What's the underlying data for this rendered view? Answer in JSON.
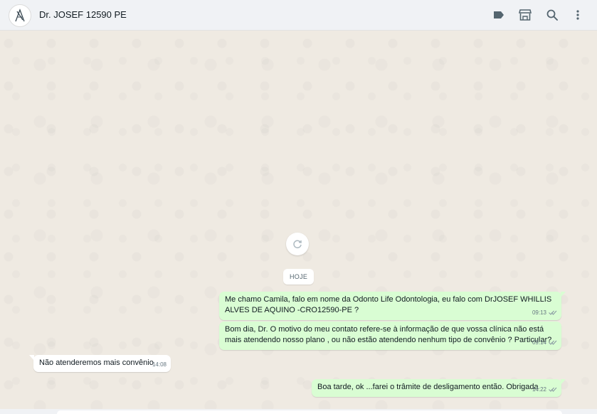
{
  "header": {
    "contact_name": "Dr. JOSEF 12590 PE",
    "icons": [
      "label-icon",
      "store-icon",
      "search-icon",
      "menu-icon"
    ]
  },
  "chat": {
    "day_label": "HOJE",
    "messages": [
      {
        "direction": "out",
        "text": "Me chamo Camila, falo em nome da Odonto Life Odontologia, eu falo com DrJOSEF WHILLIS ALVES DE AQUINO -CRO12590-PE ?",
        "time": "09:13",
        "status": "read"
      },
      {
        "direction": "out",
        "text": "Bom dia, Dr. O motivo do meu contato refere-se à informação de que vossa clínica não está mais atendendo nosso plano , ou não estão atendendo nenhum tipo de convênio ? Particular?",
        "time": "09:14",
        "status": "read"
      },
      {
        "direction": "in",
        "text": "Não atenderemos mais convênio",
        "time": "14:08"
      },
      {
        "direction": "out",
        "text": "Boa tarde, ok ...farei o trâmite de desligamento então. Obrigada",
        "time": "14:22",
        "status": "read"
      }
    ]
  },
  "colors": {
    "chat_bg": "#efeae2",
    "outgoing_bubble": "#d9fdd3",
    "incoming_bubble": "#ffffff",
    "header_bg": "#f0f2f5",
    "read_tick": "#8696a0"
  }
}
